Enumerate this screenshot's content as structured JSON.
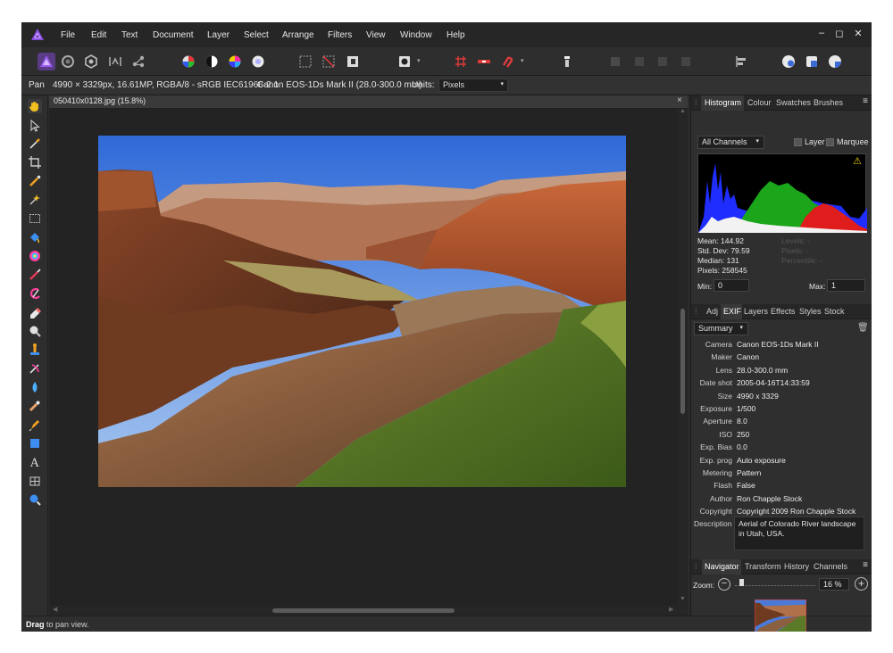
{
  "menu": [
    "File",
    "Edit",
    "Text",
    "Document",
    "Layer",
    "Select",
    "Arrange",
    "Filters",
    "View",
    "Window",
    "Help"
  ],
  "window_controls": {
    "minimize": "–",
    "maximize": "◻",
    "close": "✕"
  },
  "context": {
    "tool": "Pan",
    "image_info": "4990 × 3329px, 16.61MP, RGBA/8 - sRGB IEC61966-2.1",
    "camera_info": "Canon EOS-1Ds Mark II (28.0-300.0 mm)",
    "units_label": "Units:",
    "units_value": "Pixels"
  },
  "document": {
    "tab_title": "050410x0128.jpg (15.8%)",
    "close": "×"
  },
  "status": {
    "bold": "Drag",
    "text": " to pan view."
  },
  "histogram_panel": {
    "tabs": [
      "Histogram",
      "Colour",
      "Swatches",
      "Brushes"
    ],
    "channel": "All Channels",
    "layer_label": "Layer",
    "marquee_label": "Marquee",
    "warning_icon": "⚠",
    "mean": "Mean: 144.92",
    "std_dev": "Std. Dev: 79.59",
    "median": "Median: 131",
    "pixels": "Pixels: 258545",
    "levels": "Levels: -",
    "pixels_dim": "Pixels: -",
    "percentile": "Percentile: -",
    "min_label": "Min:",
    "min_value": "0",
    "max_label": "Max:",
    "max_value": "1"
  },
  "exif_panel": {
    "tabs": [
      "Adj",
      "EXIF",
      "Layers",
      "Effects",
      "Styles",
      "Stock"
    ],
    "view": "Summary",
    "rows": [
      {
        "key": "Camera",
        "value": "Canon EOS-1Ds Mark II"
      },
      {
        "key": "Maker",
        "value": "Canon"
      },
      {
        "key": "Lens",
        "value": "28.0-300.0 mm"
      },
      {
        "key": "Date shot",
        "value": "2005-04-16T14:33:59"
      },
      {
        "key": "Size",
        "value": "4990 x 3329"
      },
      {
        "key": "Exposure",
        "value": "1/500"
      },
      {
        "key": "Aperture",
        "value": "8.0"
      },
      {
        "key": "ISO",
        "value": "250"
      },
      {
        "key": "Exp. Bias",
        "value": "0.0"
      },
      {
        "key": "Exp. prog",
        "value": "Auto exposure"
      },
      {
        "key": "Metering",
        "value": "Pattern"
      },
      {
        "key": "Flash",
        "value": "False"
      },
      {
        "key": "Author",
        "value": "Ron Chapple Stock"
      },
      {
        "key": "Copyright",
        "value": "Copyright 2009 Ron Chapple Stock"
      }
    ],
    "description_key": "Description",
    "description_value": "Aerial of Colorado River landscape in Utah, USA."
  },
  "navigator_panel": {
    "tabs": [
      "Navigator",
      "Transform",
      "History",
      "Channels"
    ],
    "zoom_label": "Zoom:",
    "zoom_value": "16 %",
    "zoom_fraction": 0.16
  },
  "colors": {
    "accent_purple": "#7b3fd1",
    "histogram_blue": "#1f2dff",
    "histogram_green": "#1aa51a",
    "histogram_red": "#e01d1d"
  }
}
